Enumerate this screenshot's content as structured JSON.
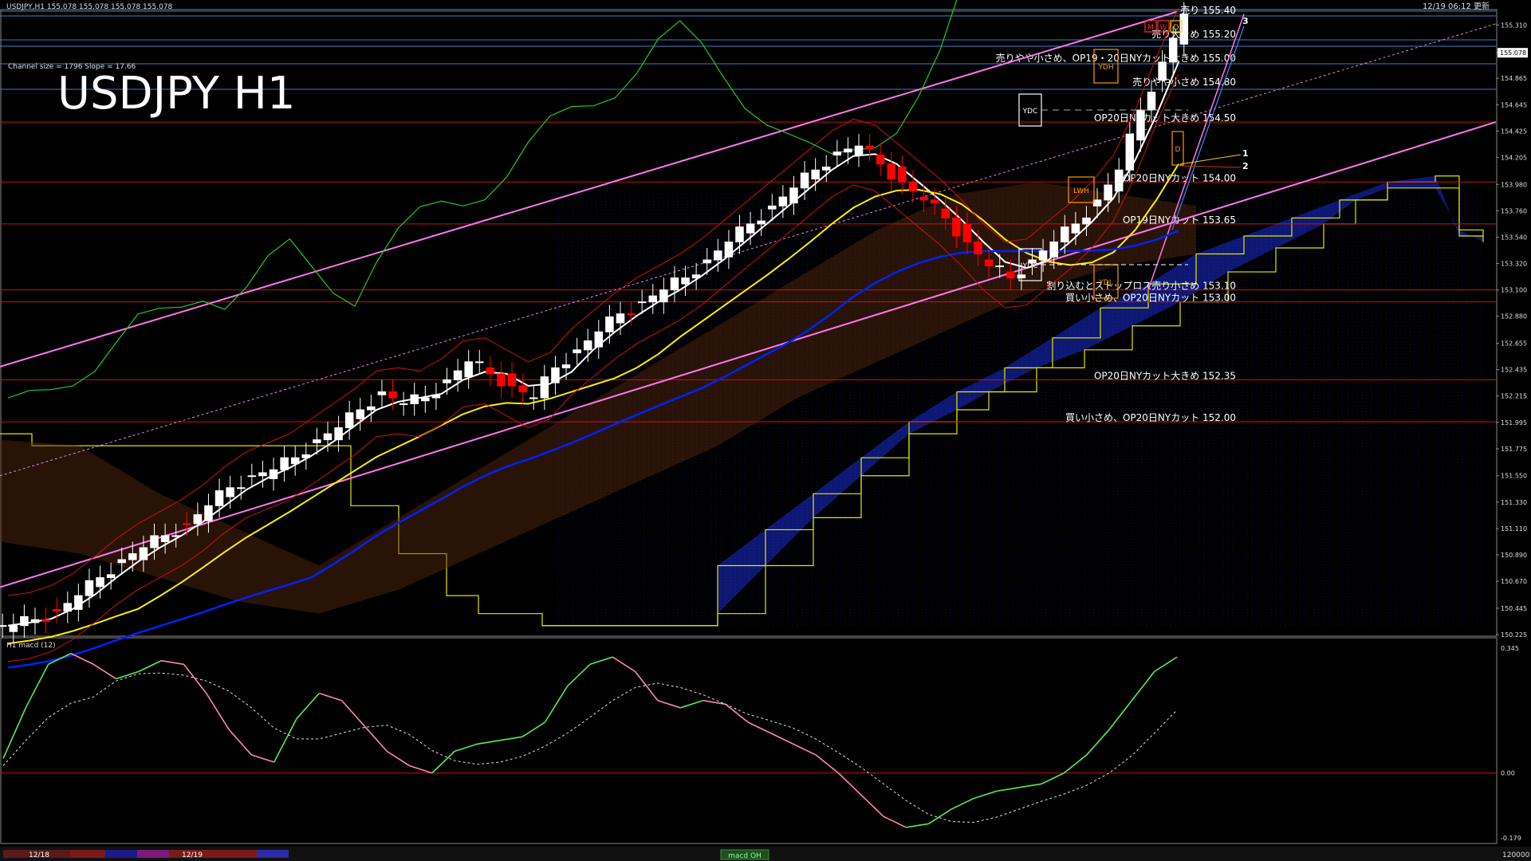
{
  "window": {
    "header_left": "USDJPY,H1  155.078 155.078 155.078 155.078",
    "header_right": "12/19 06:12 更新",
    "channel_info": "Channel size = 1796 Slope = 17.66",
    "big_title": "USDJPY H1",
    "macd_label": "H1  macd (12)",
    "current_price": "155.078"
  },
  "colors": {
    "background": "#000000",
    "bull_candle": "#ffffff",
    "bear_candle": "#ff0000",
    "level_line": "#cc1111",
    "blue_level": "#3a7fd0",
    "channel": "#ff77ee",
    "ma_white": "#ffffff",
    "ma_yellow": "#ffee00",
    "ma_blue": "#0022ff",
    "chikou": "#22cc22",
    "kumo_lines": "#e6e600",
    "kumo_fill": "#1a2bd0",
    "macd_up": "#55ee55",
    "macd_down": "#ff88aa",
    "macd_signal": "#dddddd"
  },
  "chart_data": {
    "type": "line",
    "symbol": "USDJPY",
    "timeframe": "H1",
    "ylim": [
      150.225,
      155.425
    ],
    "price_ticks": [
      "155.310",
      "155.078",
      "154.865",
      "154.645",
      "154.425",
      "154.205",
      "153.980",
      "153.760",
      "153.540",
      "153.320",
      "153.100",
      "152.880",
      "152.655",
      "152.435",
      "152.215",
      "151.995",
      "151.775",
      "151.550",
      "151.330",
      "151.110",
      "150.890",
      "150.670",
      "150.445",
      "150.225"
    ],
    "series": [
      {
        "values": [
          150.3,
          150.35,
          150.42,
          150.55,
          150.7,
          150.85,
          150.95,
          151.05,
          151.15,
          151.3,
          151.45,
          151.55,
          151.6,
          151.7,
          151.85,
          151.95,
          152.1,
          152.25,
          152.15,
          152.2,
          152.35,
          152.5,
          152.4,
          152.3,
          152.2,
          152.45,
          152.6,
          152.75,
          152.9,
          153.0,
          153.1,
          153.2,
          153.35,
          153.5,
          153.65,
          153.8,
          153.95,
          154.1,
          154.25,
          154.3,
          154.15,
          154.0,
          153.85,
          153.7,
          153.5,
          153.3,
          153.2,
          153.35,
          153.5,
          153.65,
          153.85,
          154.1,
          154.6,
          155.0,
          155.4
        ]
      }
    ],
    "levels": [
      {
        "price": 155.4,
        "label": "売り 155.40"
      },
      {
        "price": 155.2,
        "label": "売り大きめ 155.20"
      },
      {
        "price": 155.0,
        "label": "売りやや小さめ、OP19・20日NYカット大きめ 155.00"
      },
      {
        "price": 154.8,
        "label": "売りやや小さめ 154.80"
      },
      {
        "price": 154.5,
        "label": "OP20日NYカット大きめ 154.50"
      },
      {
        "price": 154.0,
        "label": "OP20日NYカット 154.00"
      },
      {
        "price": 153.65,
        "label": "OP19日NYカット 153.65"
      },
      {
        "price": 153.1,
        "label": "割り込むとストップロス売り小さめ 153.10"
      },
      {
        "price": 153.0,
        "label": "買い小さめ、OP20日NYカット 153.00"
      },
      {
        "price": 152.35,
        "label": "OP20日NYカット大きめ 152.35"
      },
      {
        "price": 152.0,
        "label": "買い小さめ、OP20日NYカット 152.00"
      }
    ],
    "markers": {
      "ydc": "YDC",
      "ydh": "YDH",
      "ydl": "YDL",
      "lwh": "LWH",
      "mwd": [
        "M",
        "W",
        "D"
      ],
      "d": "D",
      "line_nums": [
        "1",
        "2",
        "3"
      ]
    },
    "macd": {
      "ticks": [
        "0.345",
        "0.00",
        "-0.179"
      ],
      "ylim": [
        -0.19,
        0.36
      ],
      "values": [
        0.04,
        0.18,
        0.3,
        0.33,
        0.3,
        0.26,
        0.28,
        0.31,
        0.3,
        0.22,
        0.12,
        0.05,
        0.03,
        0.15,
        0.22,
        0.2,
        0.13,
        0.06,
        0.02,
        0.0,
        0.06,
        0.08,
        0.09,
        0.1,
        0.14,
        0.24,
        0.3,
        0.32,
        0.28,
        0.2,
        0.18,
        0.2,
        0.19,
        0.14,
        0.11,
        0.08,
        0.05,
        0.0,
        -0.06,
        -0.12,
        -0.15,
        -0.14,
        -0.1,
        -0.07,
        -0.05,
        -0.04,
        -0.03,
        0.0,
        0.05,
        0.12,
        0.2,
        0.28,
        0.32
      ]
    }
  },
  "bottom_bar": {
    "date1": "12/18",
    "date2": "12/19",
    "tab": "macd OH",
    "right_val": "120000"
  }
}
